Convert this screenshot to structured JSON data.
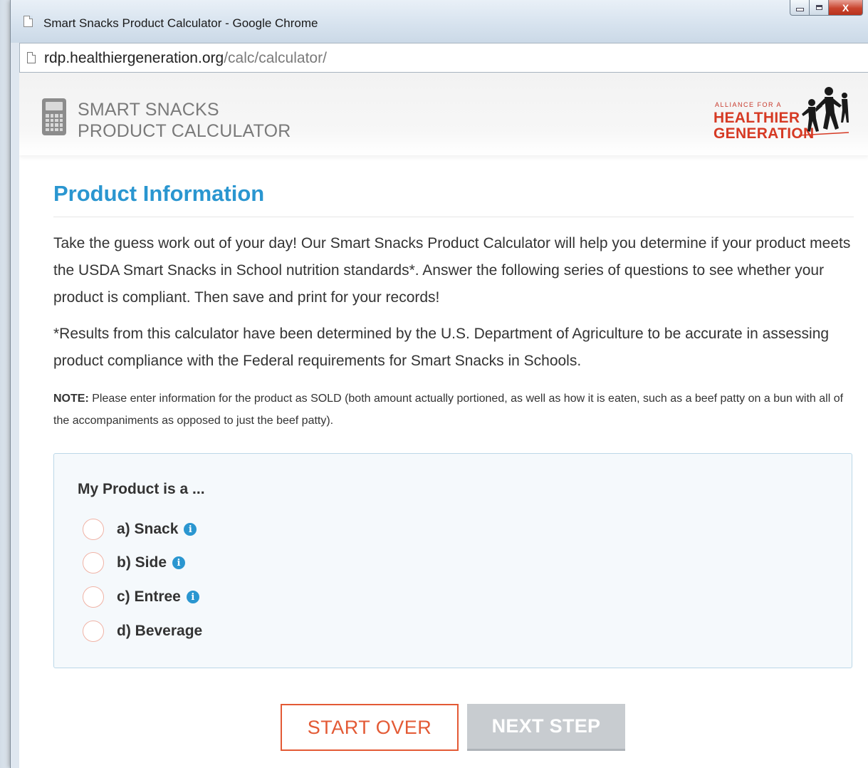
{
  "window": {
    "title": "Smart Snacks Product Calculator - Google Chrome",
    "controls": {
      "minimize": "minimize",
      "maximize": "maximize",
      "close": "X"
    }
  },
  "address_bar": {
    "domain": "rdp.healthiergeneration.org",
    "path": "/calc/calculator/"
  },
  "header": {
    "brand_line1": "SMART SNACKS",
    "brand_line2": "PRODUCT CALCULATOR",
    "calculator_icon": "calculator-icon",
    "logo": {
      "small": "ALLIANCE FOR A",
      "line1": "HEALTHIER",
      "line2": "GENERATION",
      "icon": "running-children-icon"
    }
  },
  "main": {
    "section_title": "Product Information",
    "intro": "Take the guess work out of your day! Our Smart Snacks Product Calculator will help you determine if your product meets the USDA Smart Snacks in School nutrition standards*. Answer the following series of questions to see whether your product is compliant. Then save and print for your records!",
    "disclaimer": "*Results from this calculator have been determined by the U.S. Department of Agriculture to be accurate in assessing product compliance with the Federal requirements for Smart Snacks in Schools.",
    "note_label": "NOTE:",
    "note_text": " Please enter information for the product as SOLD (both amount actually portioned, as well as how it is eaten, such as a beef patty on a bun with all of the accompaniments as opposed to just the beef patty).",
    "question": {
      "title": "My Product is a ...",
      "options": [
        {
          "label": "a) Snack",
          "has_info": true
        },
        {
          "label": "b) Side",
          "has_info": true
        },
        {
          "label": "c) Entree",
          "has_info": true
        },
        {
          "label": "d) Beverage",
          "has_info": false
        }
      ],
      "info_glyph": "i"
    },
    "buttons": {
      "start_over": "START OVER",
      "next_step": "NEXT STEP"
    }
  },
  "colors": {
    "accent_blue": "#2a96d0",
    "accent_orange": "#e35a35",
    "logo_red": "#d63a24",
    "disabled_gray": "#c8ccd0"
  }
}
